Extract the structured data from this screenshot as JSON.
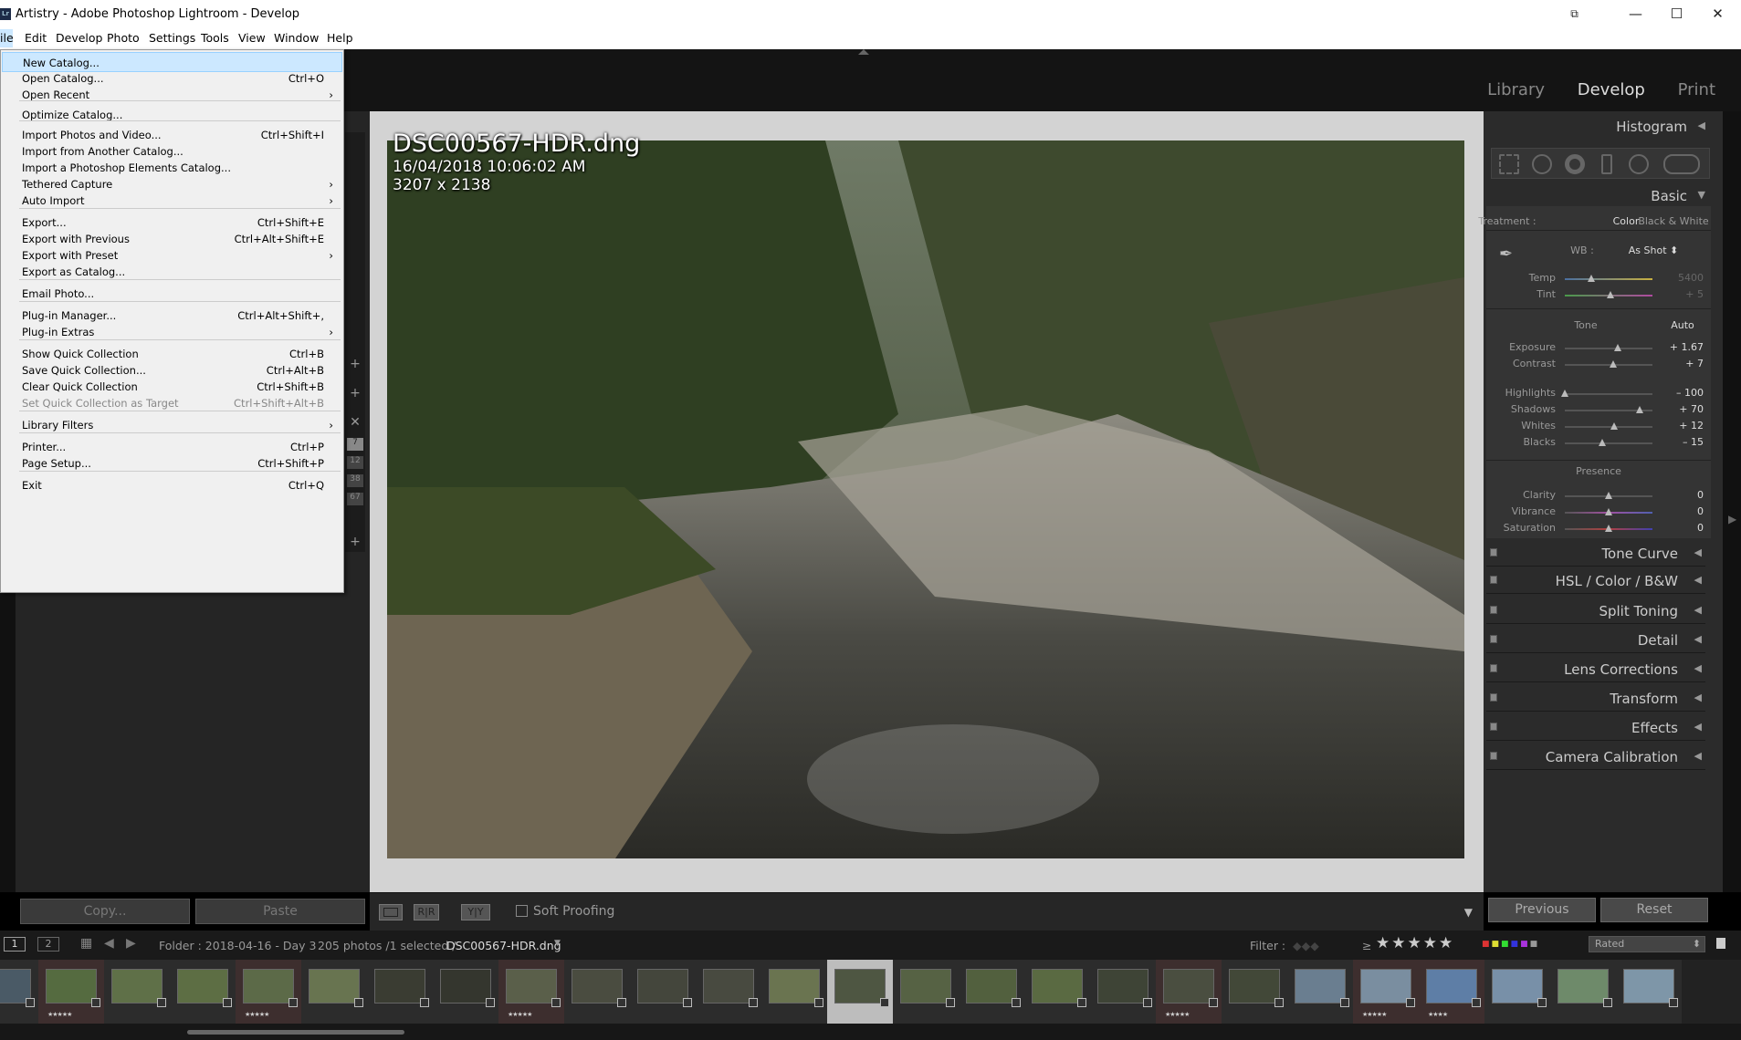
{
  "window": {
    "app_icon": "Lr",
    "title": "Artistry - Adobe Photoshop Lightroom - Develop",
    "controls": [
      "⧉",
      "—",
      "☐",
      "✕"
    ]
  },
  "menubar": {
    "items": [
      "ile",
      "Edit",
      "Develop",
      "Photo",
      "Settings",
      "Tools",
      "View",
      "Window",
      "Help"
    ]
  },
  "modules": {
    "library": "Library",
    "develop": "Develop",
    "print": "Print"
  },
  "file_menu": {
    "items": [
      {
        "label": "New Catalog...",
        "shortcut": ""
      },
      {
        "label": "Open Catalog...",
        "shortcut": "Ctrl+O"
      },
      {
        "label": "Open Recent",
        "shortcut": "",
        "submenu": true
      },
      {
        "label": "Optimize Catalog...",
        "shortcut": ""
      },
      {
        "label": "Import Photos and Video...",
        "shortcut": "Ctrl+Shift+I"
      },
      {
        "label": "Import from Another Catalog...",
        "shortcut": ""
      },
      {
        "label": "Import a Photoshop Elements Catalog...",
        "shortcut": ""
      },
      {
        "label": "Tethered Capture",
        "shortcut": "",
        "submenu": true
      },
      {
        "label": "Auto Import",
        "shortcut": "",
        "submenu": true
      },
      {
        "label": "Export...",
        "shortcut": "Ctrl+Shift+E"
      },
      {
        "label": "Export with Previous",
        "shortcut": "Ctrl+Alt+Shift+E"
      },
      {
        "label": "Export with Preset",
        "shortcut": "",
        "submenu": true
      },
      {
        "label": "Export as Catalog...",
        "shortcut": ""
      },
      {
        "label": "Email Photo...",
        "shortcut": ""
      },
      {
        "label": "Plug-in Manager...",
        "shortcut": "Ctrl+Alt+Shift+,"
      },
      {
        "label": "Plug-in Extras",
        "shortcut": "",
        "submenu": true
      },
      {
        "label": "Show Quick Collection",
        "shortcut": "Ctrl+B"
      },
      {
        "label": "Save Quick Collection...",
        "shortcut": "Ctrl+Alt+B"
      },
      {
        "label": "Clear Quick Collection",
        "shortcut": "Ctrl+Shift+B"
      },
      {
        "label": "Set Quick Collection as Target",
        "shortcut": "Ctrl+Shift+Alt+B",
        "disabled": true
      },
      {
        "label": "Library Filters",
        "shortcut": "",
        "submenu": true
      },
      {
        "label": "Printer...",
        "shortcut": "Ctrl+P"
      },
      {
        "label": "Page Setup...",
        "shortcut": "Ctrl+Shift+P"
      },
      {
        "label": "Exit",
        "shortcut": "Ctrl+Q"
      }
    ]
  },
  "left_panel": {
    "side_buttons": [
      "+",
      "+",
      "✕",
      "+"
    ],
    "side_numbers": [
      "7",
      "12",
      "38",
      "67"
    ],
    "copy": "Copy...",
    "paste": "Paste"
  },
  "photo_info": {
    "filename": "DSC00567-HDR.dng",
    "datetime": "16/04/2018 10:06:02 AM",
    "dimensions": "3207 x 2138"
  },
  "toolbar": {
    "soft_proofing": "Soft Proofing",
    "view_modes": [
      "",
      "R|R",
      "Y|Y"
    ]
  },
  "right_panel": {
    "histogram": "Histogram",
    "basic": {
      "title": "Basic",
      "treatment_label": "Treatment :",
      "treatment_color": "Color",
      "treatment_bw": "Black & White",
      "wb_label": "WB :",
      "wb_value": "As Shot ⬍",
      "tone_label": "Tone",
      "auto": "Auto",
      "presence_label": "Presence",
      "sliders": [
        {
          "label": "Temp",
          "value": "5400",
          "pos": 0.3
        },
        {
          "label": "Tint",
          "value": "+ 5",
          "pos": 0.52
        },
        {
          "label": "Exposure",
          "value": "+ 1.67",
          "pos": 0.6
        },
        {
          "label": "Contrast",
          "value": "+ 7",
          "pos": 0.55
        },
        {
          "label": "Highlights",
          "value": "– 100",
          "pos": 0.0
        },
        {
          "label": "Shadows",
          "value": "+ 70",
          "pos": 0.85
        },
        {
          "label": "Whites",
          "value": "+ 12",
          "pos": 0.56
        },
        {
          "label": "Blacks",
          "value": "– 15",
          "pos": 0.43
        },
        {
          "label": "Clarity",
          "value": "0",
          "pos": 0.5
        },
        {
          "label": "Vibrance",
          "value": "0",
          "pos": 0.5
        },
        {
          "label": "Saturation",
          "value": "0",
          "pos": 0.5
        }
      ]
    },
    "panels": [
      "Tone Curve",
      "HSL / Color / B&W",
      "Split Toning",
      "Detail",
      "Lens Corrections",
      "Transform",
      "Effects",
      "Camera Calibration"
    ],
    "previous": "Previous",
    "reset": "Reset"
  },
  "filmstrip_bar": {
    "screen1": "1",
    "screen2": "2",
    "folder": "Folder : 2018-04-16 - Day 3",
    "count": "205 photos /1 selected /",
    "selected_file": "DSC00567-HDR.dng",
    "filter_label": "Filter :",
    "rating_op": "≥",
    "stars": "★★★★★",
    "rated": "Rated"
  },
  "thumbnails": [
    {
      "stars": "",
      "color": "#4a5a66"
    },
    {
      "stars": "★★★★★",
      "color": "#556b40"
    },
    {
      "stars": "",
      "color": "#5f7048"
    },
    {
      "stars": "",
      "color": "#5d6e44"
    },
    {
      "stars": "★★★★★",
      "color": "#5c6a48"
    },
    {
      "stars": "",
      "color": "#687450"
    },
    {
      "stars": "",
      "color": "#3a3c32"
    },
    {
      "stars": "",
      "color": "#34362e"
    },
    {
      "stars": "★★★★★",
      "color": "#5a5f4a"
    },
    {
      "stars": "",
      "color": "#4a4c40"
    },
    {
      "stars": "",
      "color": "#44463c"
    },
    {
      "stars": "",
      "color": "#484a40"
    },
    {
      "stars": "",
      "color": "#6a7450"
    },
    {
      "stars": "",
      "color": "#4e5642"
    },
    {
      "stars": "",
      "color": "#566244"
    },
    {
      "stars": "",
      "color": "#52603e"
    },
    {
      "stars": "",
      "color": "#5a6a42"
    },
    {
      "stars": "",
      "color": "#3e4436"
    },
    {
      "stars": "★★★★★",
      "color": "#4a4e40"
    },
    {
      "stars": "",
      "color": "#424838"
    },
    {
      "stars": "",
      "color": "#6a7e90"
    },
    {
      "stars": "★★★★★",
      "color": "#7a8ea0"
    },
    {
      "stars": "★★★★",
      "color": "#5e7ea6"
    },
    {
      "stars": "",
      "color": "#7890a8"
    },
    {
      "stars": "",
      "color": "#6e8a6a"
    },
    {
      "stars": "",
      "color": "#7e96a8"
    }
  ]
}
